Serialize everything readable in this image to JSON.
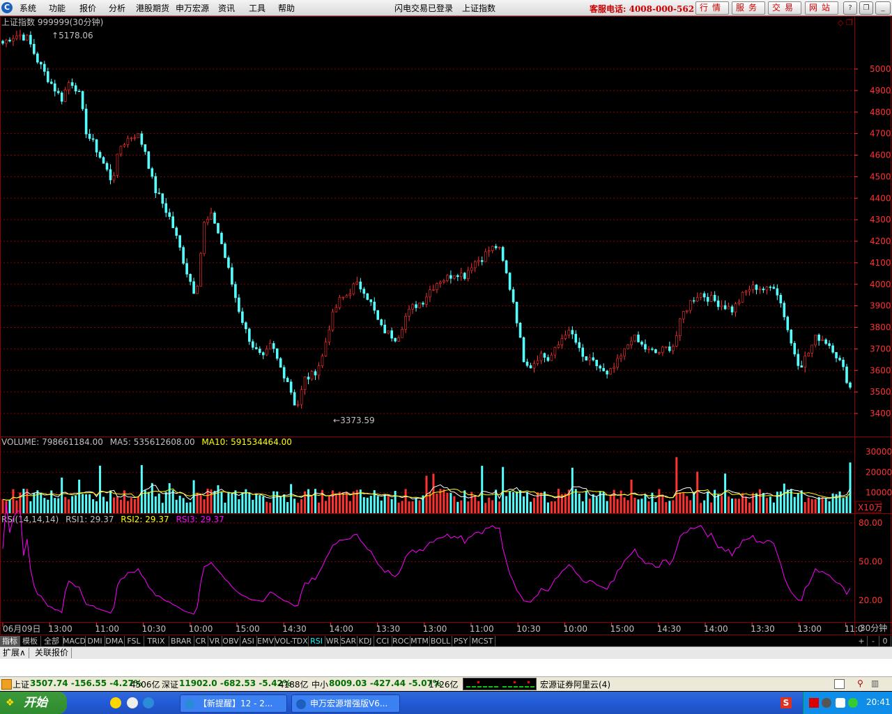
{
  "menu": {
    "items": [
      "系统",
      "功能",
      "报价",
      "分析",
      "港股期货",
      "申万宏源",
      "资讯",
      "工具",
      "帮助"
    ],
    "login_status": "闪电交易已登录",
    "current_index": "上证指数",
    "hotline": "客服电话: 4008-000-562",
    "buttons": [
      "行情",
      "服务",
      "交易",
      "网站"
    ],
    "window_buttons": [
      "?",
      "❐",
      "_",
      "✕"
    ]
  },
  "chart": {
    "header": "上证指数 999999(30分钟)",
    "corner_glyphs": "◇ ❐",
    "high_label": "5178.06",
    "low_label": "3373.59",
    "price_ticks": [
      "5000",
      "4900",
      "4800",
      "4700",
      "4600",
      "4500",
      "4400",
      "4300",
      "4200",
      "4100",
      "4000",
      "3900",
      "3800",
      "3700",
      "3600",
      "3500",
      "3400"
    ],
    "volume_header": {
      "volume": "VOLUME: 798661184.00",
      "ma5": "MA5: 535612608.00",
      "ma10": "MA10: 591534464.00"
    },
    "volume_ticks": [
      "30000",
      "20000",
      "10000"
    ],
    "volume_unit": "X10万",
    "rsi_header": {
      "params": "RSI(14,14,14)",
      "rsi1": "RSI1: 29.37",
      "rsi2": "RSI2: 29.37",
      "rsi3": "RSI3: 29.37"
    },
    "rsi_ticks": [
      "80.00",
      "50.00",
      "20.00"
    ],
    "time_labels": [
      "06月09日",
      "13:00",
      "11:00",
      "10:30",
      "10:00",
      "15:00",
      "14:30",
      "14:00",
      "13:30",
      "13:00",
      "11:00",
      "10:30",
      "10:00",
      "15:00",
      "14:30",
      "14:00",
      "13:30",
      "13:00",
      "11:0"
    ],
    "period_label": "30分钟",
    "colors": {
      "up": "#ff3232",
      "down": "#54ffff",
      "rsi": "#ff00ff",
      "ma5": "#ffffff",
      "ma10": "#ffff00",
      "grid": "#8b0000"
    }
  },
  "chart_data": {
    "type": "candlestick",
    "title": "上证指数 999999(30分钟)",
    "price_range": [
      3373.59,
      5178.06
    ],
    "marked_high": 5178.06,
    "marked_low": 3373.59,
    "close_points": [
      5120,
      5150,
      5160,
      5140,
      5050,
      4980,
      4920,
      4860,
      4950,
      4900,
      4700,
      4640,
      4560,
      4480,
      4640,
      4680,
      4700,
      4620,
      4450,
      4380,
      4300,
      4180,
      4050,
      3950,
      4280,
      4320,
      4200,
      4050,
      3900,
      3780,
      3700,
      3650,
      3720,
      3620,
      3550,
      3420,
      3560,
      3580,
      3650,
      3820,
      3920,
      3950,
      4000,
      3980,
      3900,
      3800,
      3770,
      3750,
      3850,
      3900,
      3920,
      3980,
      4020,
      4030,
      4060,
      4040,
      4100,
      4120,
      4160,
      4180,
      4050,
      3900,
      3660,
      3620,
      3680,
      3650,
      3700,
      3780,
      3760,
      3660,
      3640,
      3620,
      3570,
      3620,
      3680,
      3760,
      3720,
      3690,
      3680,
      3700,
      3720,
      3860,
      3920,
      3960,
      3940,
      3920,
      3900,
      3880,
      3940,
      3980,
      3990,
      3970,
      4000,
      3880,
      3720,
      3620,
      3680,
      3760,
      3740,
      3700,
      3620,
      3520
    ],
    "volume_scale_ticks": [
      10000,
      20000,
      30000
    ],
    "rsi": {
      "last": 29.37,
      "ticks": [
        20,
        50,
        80
      ]
    }
  },
  "indicators": [
    "指标",
    "模板",
    "全部",
    "MACD",
    "DMI",
    "DMA",
    "FSL",
    "TRIX",
    "BRAR",
    "CR",
    "VR",
    "OBV",
    "ASI",
    "EMV",
    "VOL-TDX",
    "RSI",
    "WR",
    "SAR",
    "KDJ",
    "CCI",
    "ROC",
    "MTM",
    "BOLL",
    "PSY",
    "MCST"
  ],
  "indicator_controls": [
    "+",
    "-",
    "0"
  ],
  "subtabs": [
    "扩展∧",
    "关联报价"
  ],
  "market": {
    "sh_name": "上证",
    "sh_value": "3507.74 -156.55 -4.27%",
    "sh_amount": "4506亿",
    "sz_name": "深证",
    "sz_value": "11902.0 -682.53 -5.42%",
    "sz_amount": "4188亿",
    "zx_name": "中小",
    "zx_value": "8009.03 -427.44 -5.07%",
    "zx_amount": "1726亿",
    "broker": "宏源证券阿里云(4)"
  },
  "taskbar": {
    "start": "开始",
    "tasks": [
      "【新提醒】12 - 2...",
      "申万宏源增强版V6..."
    ],
    "clock": "20:41"
  }
}
